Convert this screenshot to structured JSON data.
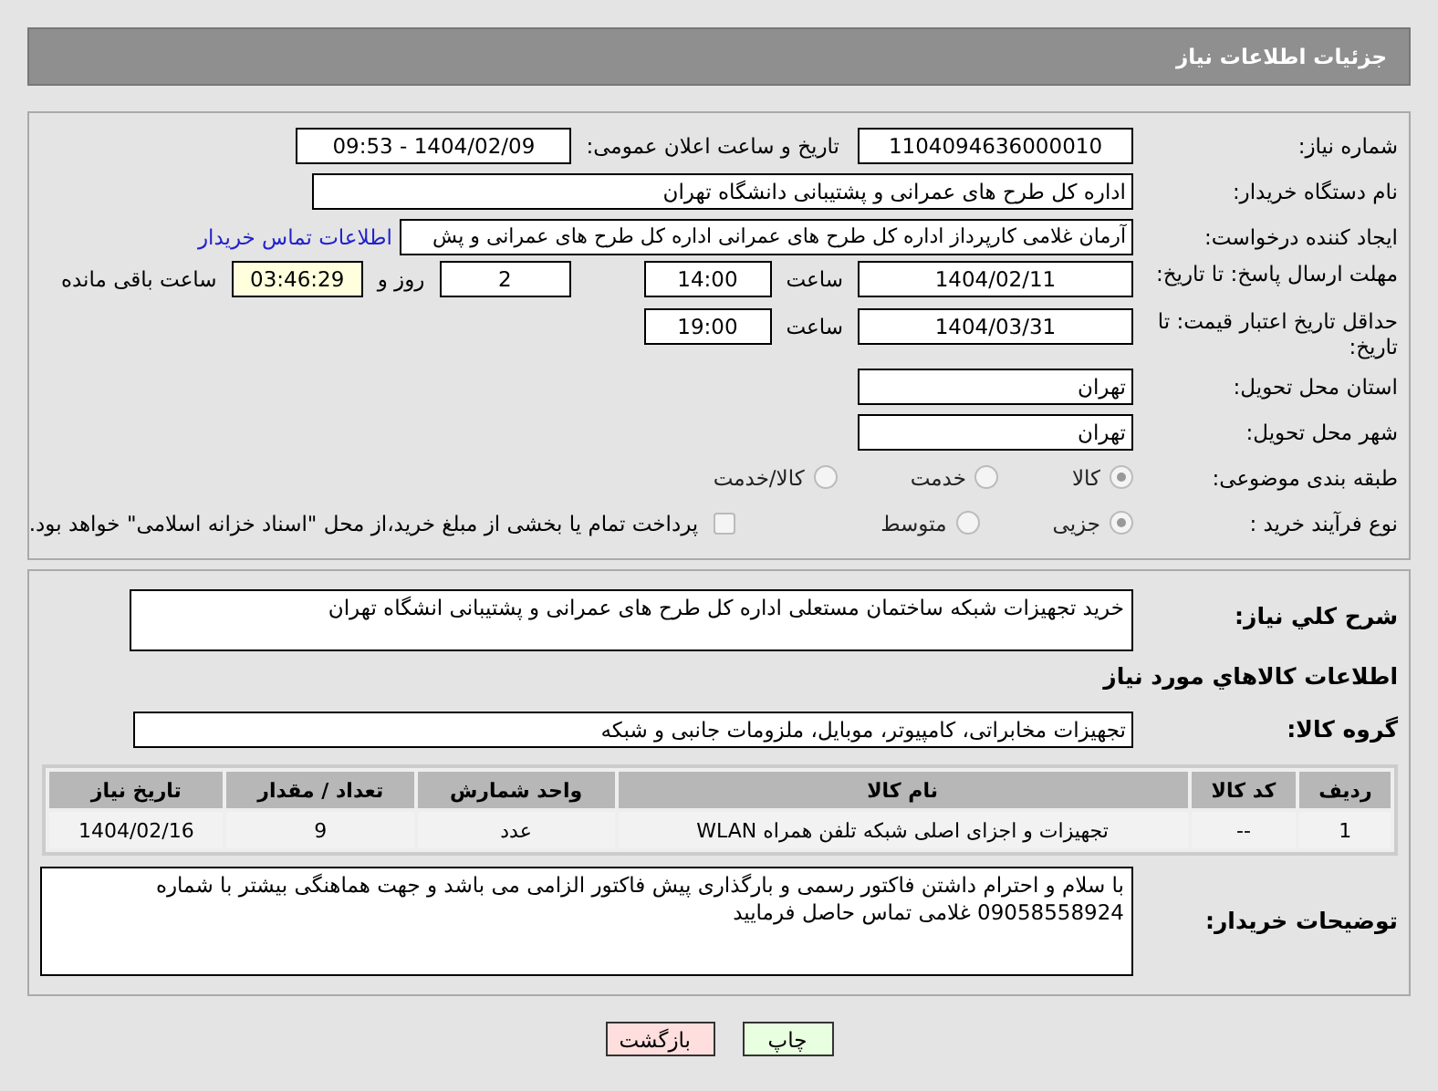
{
  "header": {
    "title": "جزئیات اطلاعات نیاز"
  },
  "need_number": {
    "label": "شماره نیاز:",
    "value": "1104094636000010"
  },
  "announce": {
    "label": "تاریخ و ساعت اعلان عمومی:",
    "value": "1404/02/09 - 09:53"
  },
  "buyer": {
    "label": "نام دستگاه خریدار:",
    "value": "اداره کل طرح های عمرانی و پشتیبانی دانشگاه تهران"
  },
  "creator": {
    "label": "ایجاد کننده درخواست:",
    "value": "آرمان غلامی کارپرداز اداره کل طرح های عمرانی اداره کل طرح های عمرانی و پش",
    "link": "اطلاعات تماس خریدار"
  },
  "deadline": {
    "label": "مهلت ارسال پاسخ: تا تاریخ:",
    "date": "1404/02/11",
    "time_label": "ساعت",
    "time": "14:00",
    "days": "2",
    "days_label": "روز و",
    "remaining": "03:46:29",
    "remaining_label": "ساعت باقی مانده"
  },
  "validity": {
    "label": "حداقل تاریخ اعتبار قیمت: تا تاریخ:",
    "date": "1404/03/31",
    "time_label": "ساعت",
    "time": "19:00"
  },
  "province": {
    "label": "استان محل تحویل:",
    "value": "تهران"
  },
  "city": {
    "label": "شهر محل تحویل:",
    "value": "تهران"
  },
  "category": {
    "label": "طبقه بندی موضوعی:",
    "options": [
      {
        "label": "کالا",
        "selected": true
      },
      {
        "label": "خدمت",
        "selected": false
      },
      {
        "label": "کالا/خدمت",
        "selected": false
      }
    ]
  },
  "process": {
    "label": "نوع فرآیند خرید :",
    "options": [
      {
        "label": "جزیی",
        "selected": true
      },
      {
        "label": "متوسط",
        "selected": false
      }
    ],
    "treasury": {
      "label": "پرداخت تمام یا بخشی از مبلغ خرید،از محل \"اسناد خزانه اسلامی\" خواهد بود.",
      "checked": false
    }
  },
  "description": {
    "label": "شرح کلي نیاز:",
    "value": "خرید تجهیزات شبکه ساختمان مستعلی اداره کل طرح های عمرانی و پشتیبانی انشگاه تهران"
  },
  "goods_heading": "اطلاعات کالاهاي مورد نیاز",
  "goods_group": {
    "label": "گروه کالا:",
    "value": "تجهیزات مخابراتی، کامپیوتر، موبایل، ملزومات جانبی و شبکه"
  },
  "table": {
    "columns": [
      "ردیف",
      "کد کالا",
      "نام کالا",
      "واحد شمارش",
      "تعداد / مقدار",
      "تاریخ نیاز"
    ],
    "rows": [
      [
        "1",
        "--",
        "تجهیزات و اجزای اصلی شبکه تلفن همراه WLAN",
        "عدد",
        "9",
        "1404/02/16"
      ]
    ]
  },
  "notes": {
    "label": "توضیحات خریدار:",
    "value": "با سلام و احترام داشتن فاکتور رسمی و بارگذاری پیش فاکتور الزامی می باشد و جهت هماهنگی بیشتر با شماره 09058558924 غلامی تماس حاصل فرمایید"
  },
  "buttons": [
    {
      "label": "چاپ",
      "kind": "print"
    },
    {
      "label": "بازگشت",
      "kind": "back"
    }
  ]
}
